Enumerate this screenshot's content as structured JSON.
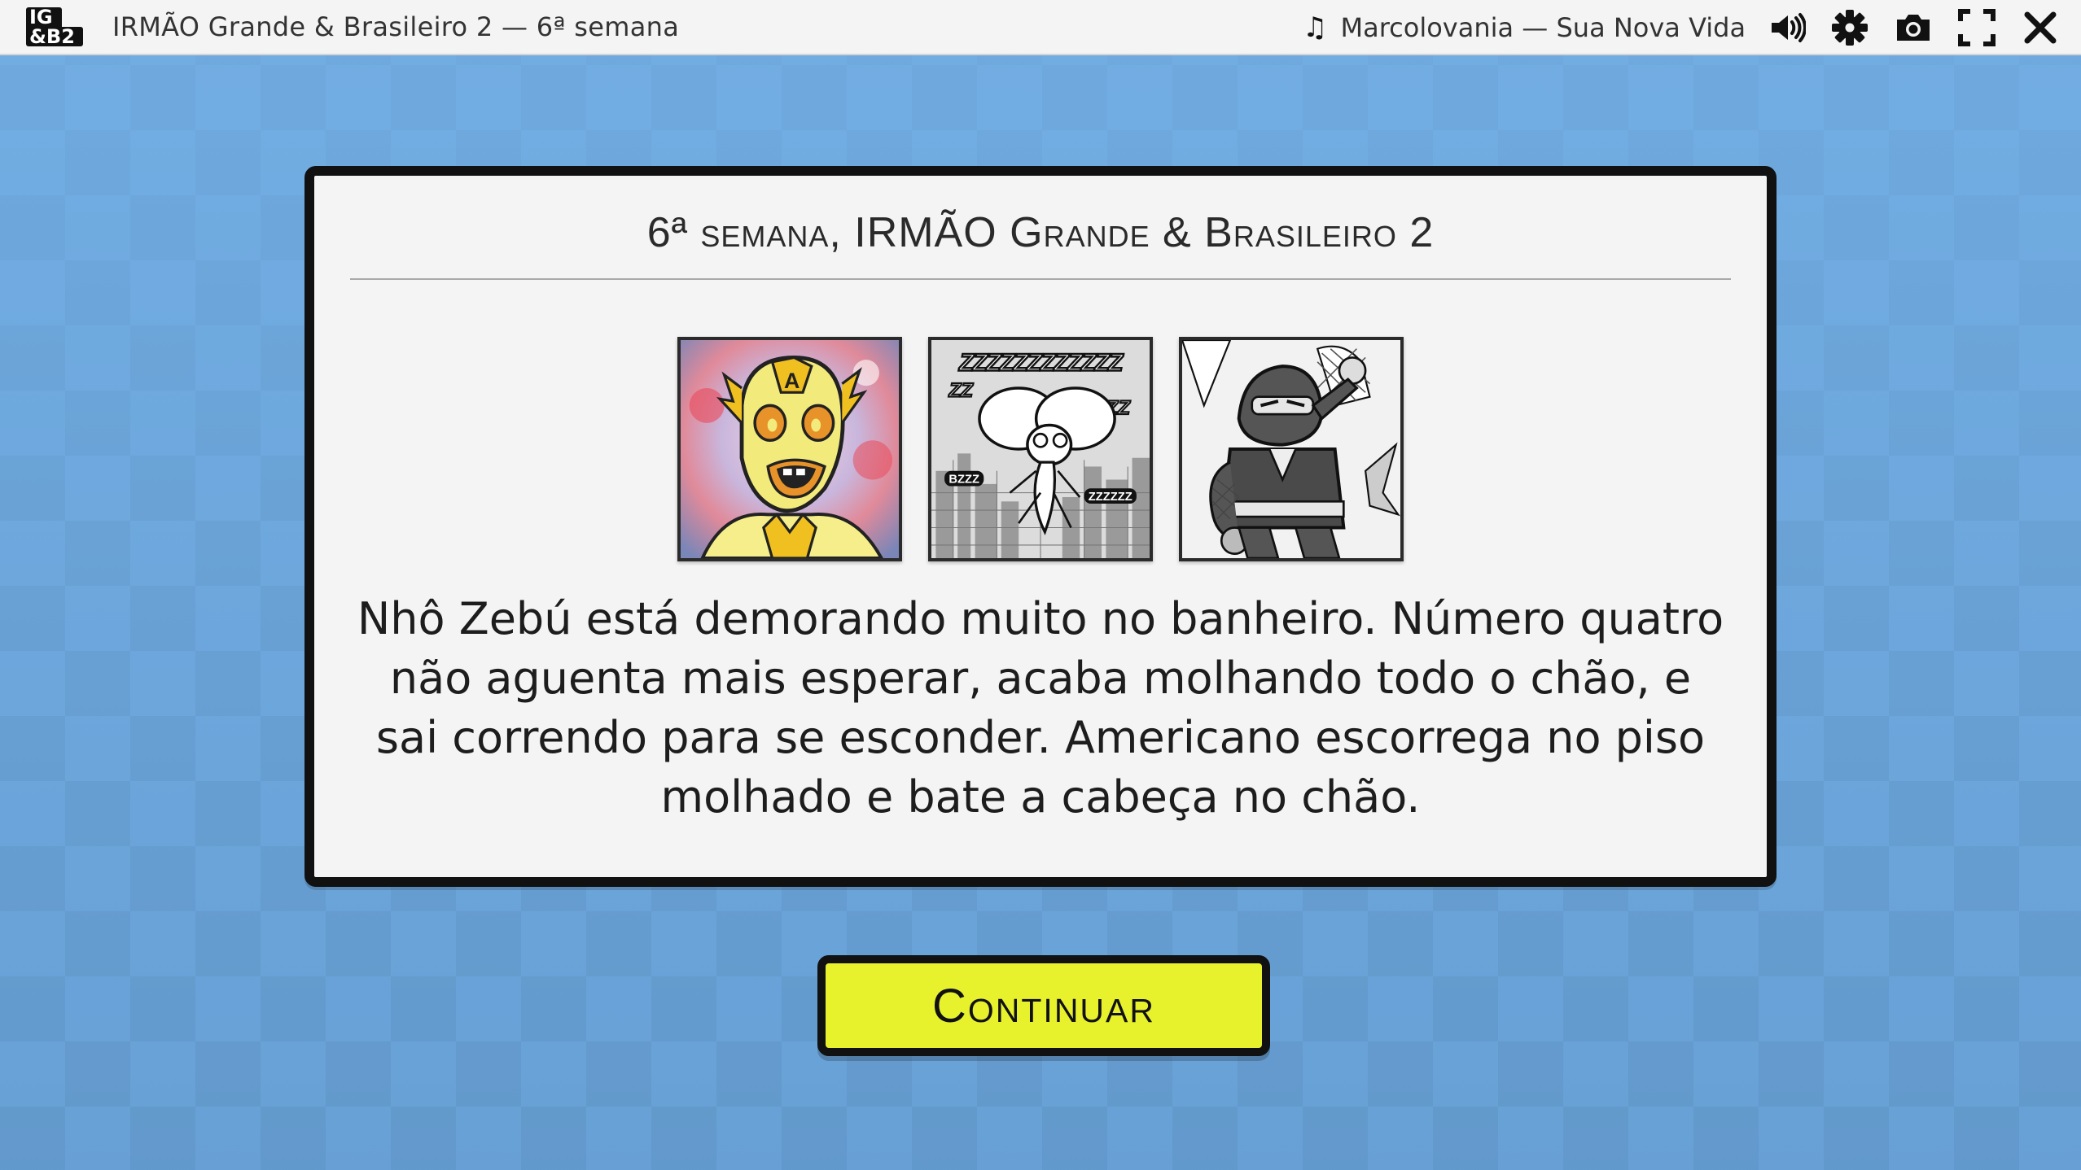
{
  "header": {
    "logo_line1": "IG",
    "logo_line2": "&B2",
    "title": "IRMÃO Grande & Brasileiro 2 — 6ª semana"
  },
  "music": {
    "icon": "music-note-icon",
    "track": "Marcolovania — Sua Nova Vida"
  },
  "controls": [
    {
      "icon": "volume-icon"
    },
    {
      "icon": "gear-icon"
    },
    {
      "icon": "camera-icon"
    },
    {
      "icon": "fullscreen-icon"
    },
    {
      "icon": "close-icon"
    }
  ],
  "dialog": {
    "title": "6ª semana, IRMÃO Grande & Brasileiro 2",
    "thumbnails": [
      {
        "icon": "masked-hero-portrait"
      },
      {
        "icon": "fly-over-city-portrait"
      },
      {
        "icon": "ninja-portrait"
      }
    ],
    "story": "Nhô Zebú está demorando muito no banheiro. Número quatro não aguenta mais esperar, acaba molhando todo o chão, e sai correndo para se esconder. Americano escorrega no piso molhado e bate a cabeça no chão."
  },
  "continue_button": {
    "label": "Continuar",
    "color": "#e8f22c"
  },
  "colors": {
    "background": "#6aa4d8",
    "topbar": "#f4f4f4",
    "dialog": "#f4f4f4",
    "border": "#111111"
  }
}
